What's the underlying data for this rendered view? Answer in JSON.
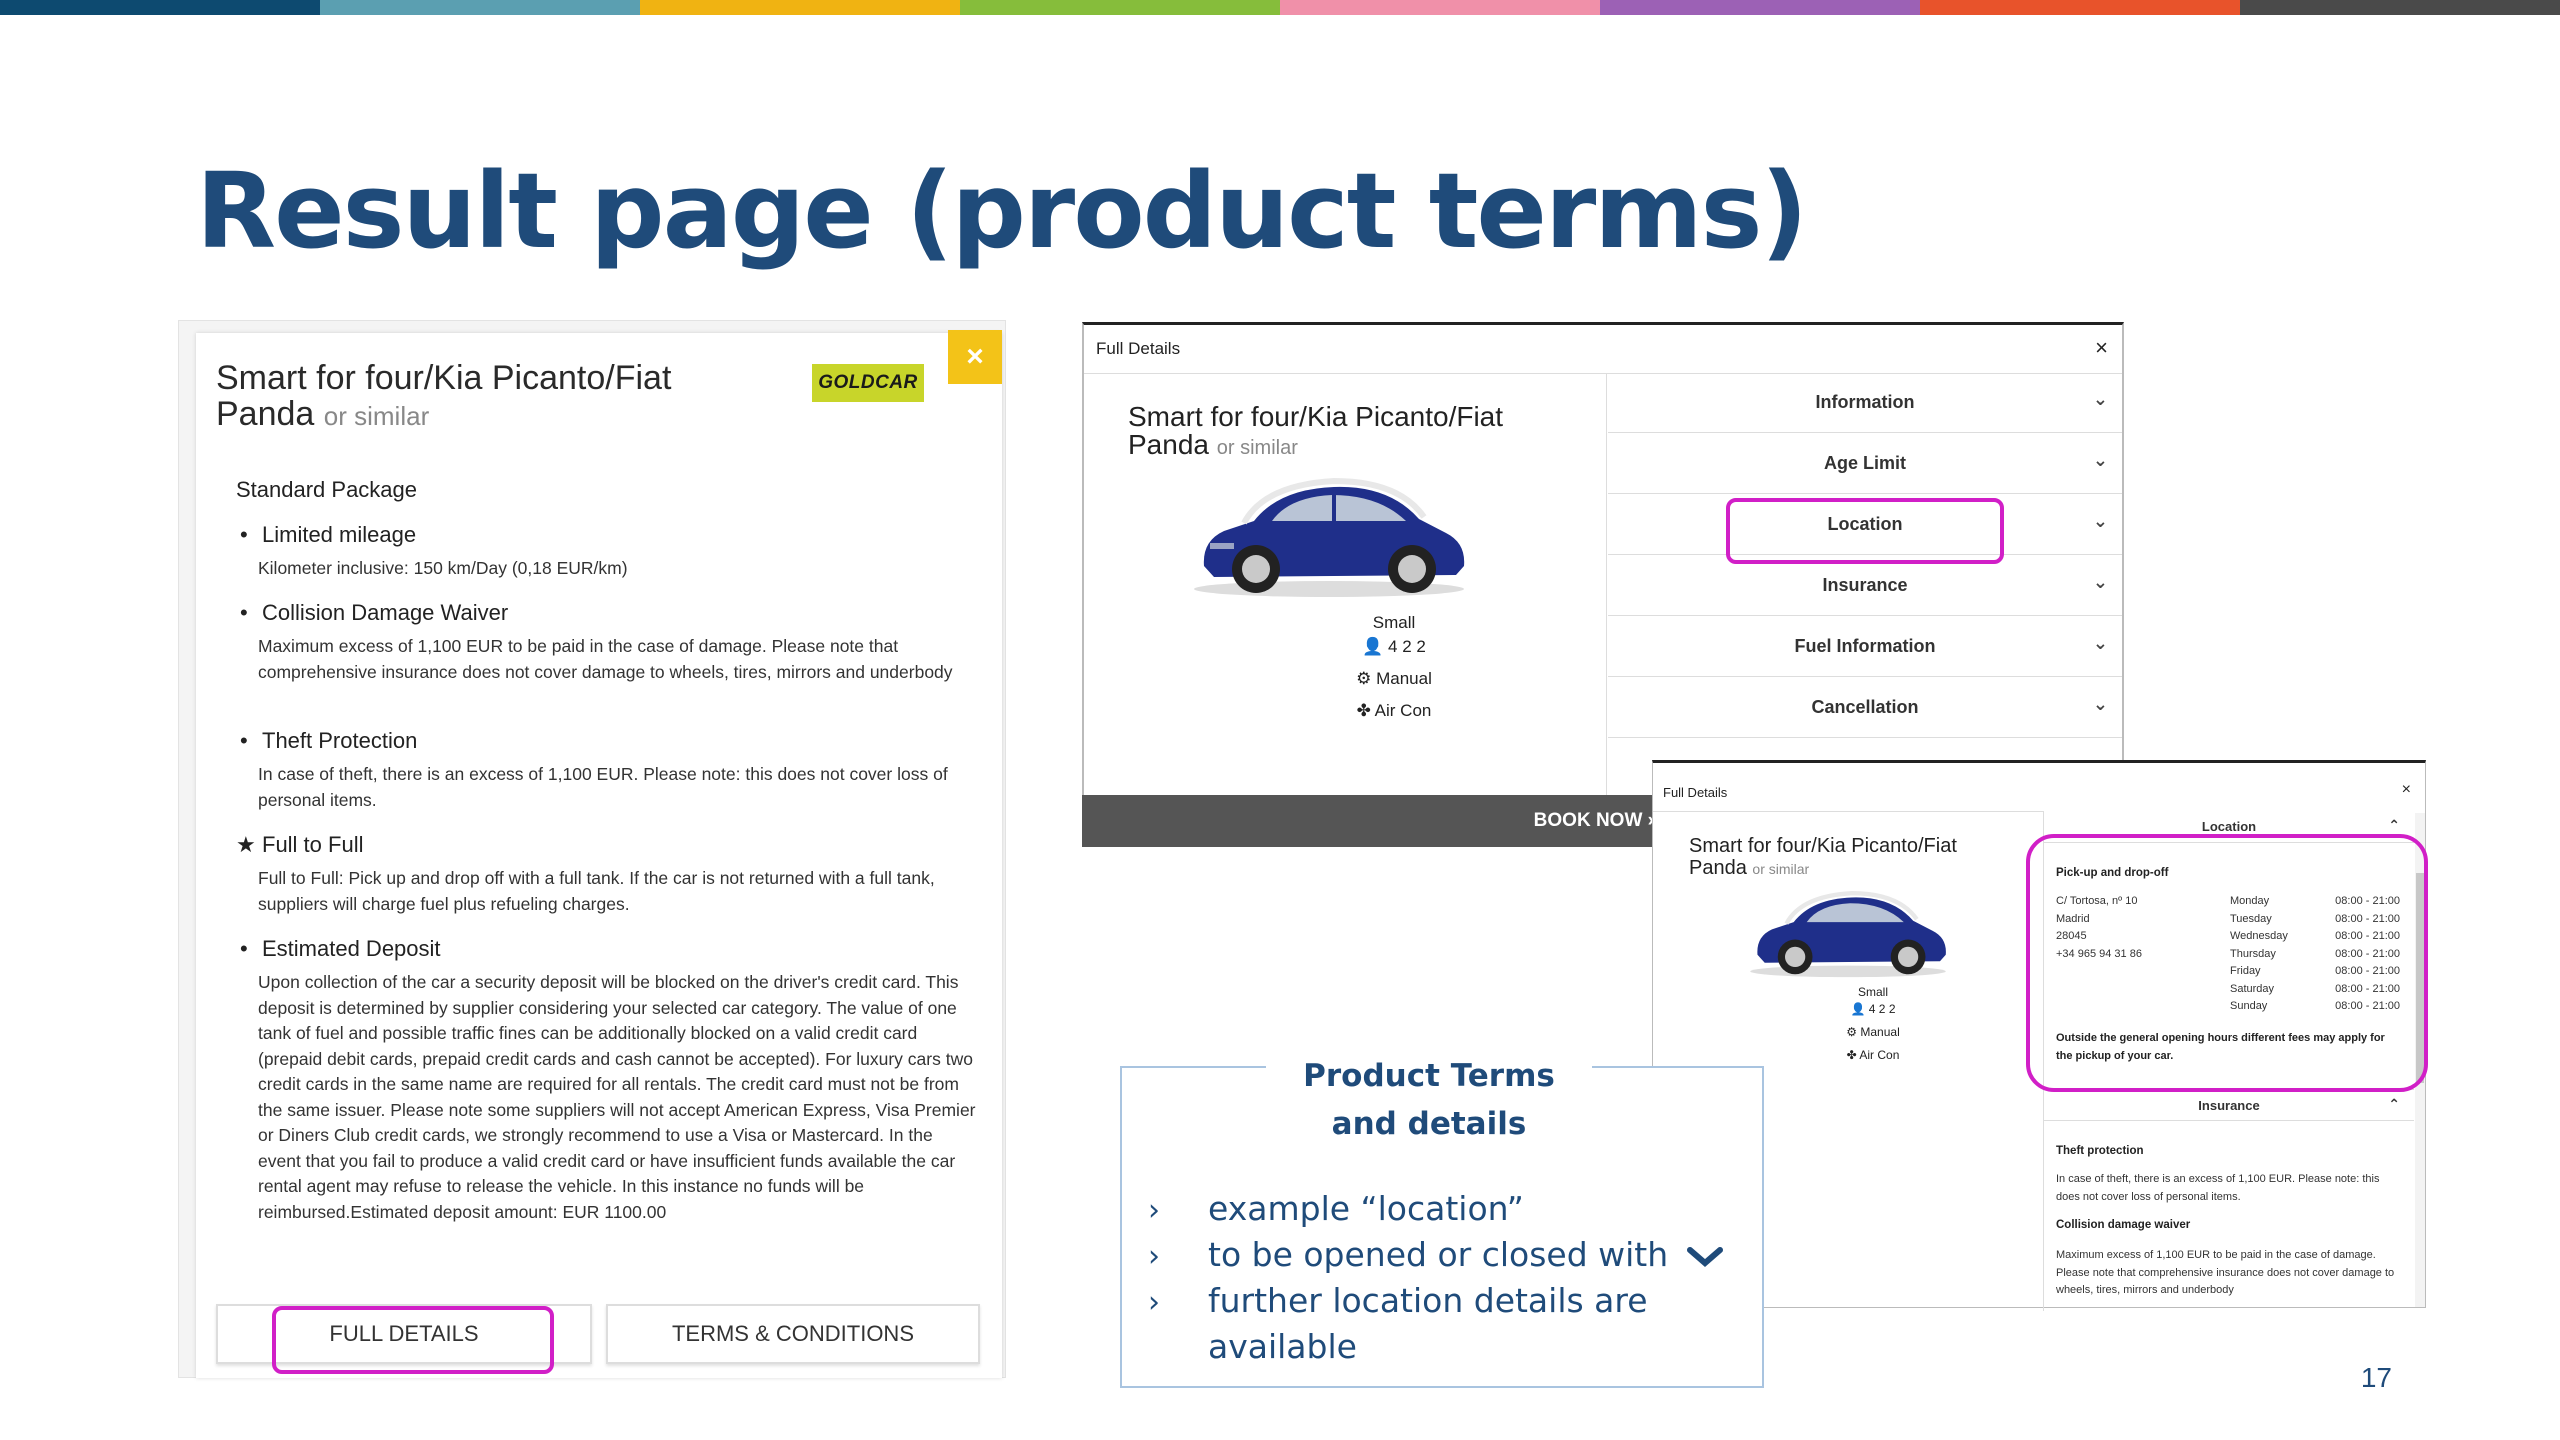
{
  "topbar": {
    "colors": [
      "#0d4a70",
      "#5b9fb1",
      "#f0b312",
      "#86bd3b",
      "#f090a9",
      "#9c61b5",
      "#e8532b",
      "#4a4a4a"
    ]
  },
  "slide": {
    "title": "Result page (product terms)",
    "page_number": "17"
  },
  "left_card": {
    "close": "×",
    "car_name": "Smart for four/Kia Picanto/Fiat Panda",
    "or_similar": "or similar",
    "supplier_logo": "GOLDCAR",
    "package_title": "Standard Package",
    "features": [
      {
        "icon": "bullet",
        "title": "Limited mileage",
        "desc": "Kilometer inclusive: 150 km/Day (0,18 EUR/km)"
      },
      {
        "icon": "bullet",
        "title": "Collision Damage Waiver",
        "desc": "Maximum excess of 1,100 EUR to be paid in the case of damage. Please note that comprehensive insurance does not cover damage to wheels, tires, mirrors and underbody"
      },
      {
        "icon": "bullet",
        "title": "Theft Protection",
        "desc": "In case of theft, there is an excess of 1,100 EUR.  Please note: this does not cover loss of personal items."
      },
      {
        "icon": "star-icon",
        "title": "Full to Full",
        "desc": "Full to Full: Pick up and drop off with a full tank. If the car is not returned with a full tank, suppliers will charge fuel plus refueling charges."
      },
      {
        "icon": "bullet",
        "title": "Estimated Deposit",
        "desc": "Upon collection of the car a security deposit will be blocked on the driver's credit card. This deposit is determined by supplier considering your selected car category. The value of one tank of fuel and possible traffic fines can be additionally blocked on a valid credit card (prepaid debit cards, prepaid credit cards and cash cannot be accepted). For luxury cars two credit cards in the same name are required for all rentals. The credit card must not be from the same issuer. Please note some suppliers will not accept American Express, Visa Premier or Diners Club credit cards, we strongly recommend to use a Visa or Mastercard. In the event that you fail to produce a valid credit card or have insufficient funds available the car rental agent may refuse to release the vehicle. In this instance no funds will be reimbursed.Estimated deposit amount: EUR 1100.00"
      }
    ],
    "buttons": {
      "full_details": "FULL DETAILS",
      "terms": "TERMS & CONDITIONS"
    }
  },
  "full_details": {
    "title": "Full Details",
    "close": "×",
    "car_name": "Smart for four/Kia Picanto/Fiat Panda",
    "or_similar": "or similar",
    "category": "Small",
    "capacity": "4  2  2",
    "transmission": "Manual",
    "aircon": "Air Con",
    "sections": [
      "Information",
      "Age Limit",
      "Location",
      "Insurance",
      "Fuel Information",
      "Cancellation"
    ],
    "book_now": "BOOK NOW ›"
  },
  "location_panel": {
    "title": "Full Details",
    "close": "×",
    "car_name": "Smart for four/Kia Picanto/Fiat Panda",
    "or_similar": "or similar",
    "category": "Small",
    "capacity": "4  2  2",
    "transmission": "Manual",
    "aircon": "Air Con",
    "location_header": "Location",
    "pickup_title": "Pick-up and drop-off",
    "address": [
      "C/ Tortosa, nº 10",
      "Madrid",
      "28045",
      "+34 965 94 31 86"
    ],
    "hours": [
      {
        "day": "Monday",
        "time": "08:00 - 21:00"
      },
      {
        "day": "Tuesday",
        "time": "08:00 - 21:00"
      },
      {
        "day": "Wednesday",
        "time": "08:00 - 21:00"
      },
      {
        "day": "Thursday",
        "time": "08:00 - 21:00"
      },
      {
        "day": "Friday",
        "time": "08:00 - 21:00"
      },
      {
        "day": "Saturday",
        "time": "08:00 - 21:00"
      },
      {
        "day": "Sunday",
        "time": "08:00 - 21:00"
      }
    ],
    "fees_note": "Outside the general opening hours different fees may apply for the pickup of your car.",
    "insurance_header": "Insurance",
    "theft_title": "Theft protection",
    "theft_text": "In case of theft, there is an excess of 1,100 EUR.  Please note: this does not cover loss of personal items.",
    "cdw_title": "Collision damage waiver",
    "cdw_text": "Maximum excess of 1,100 EUR to be paid in the case of damage. Please note that comprehensive insurance does not cover damage to wheels, tires, mirrors and underbody"
  },
  "note": {
    "title": "Product Terms and details",
    "items": [
      "example “location”",
      "to  be opened or closed with",
      "further location details are",
      "available"
    ]
  }
}
